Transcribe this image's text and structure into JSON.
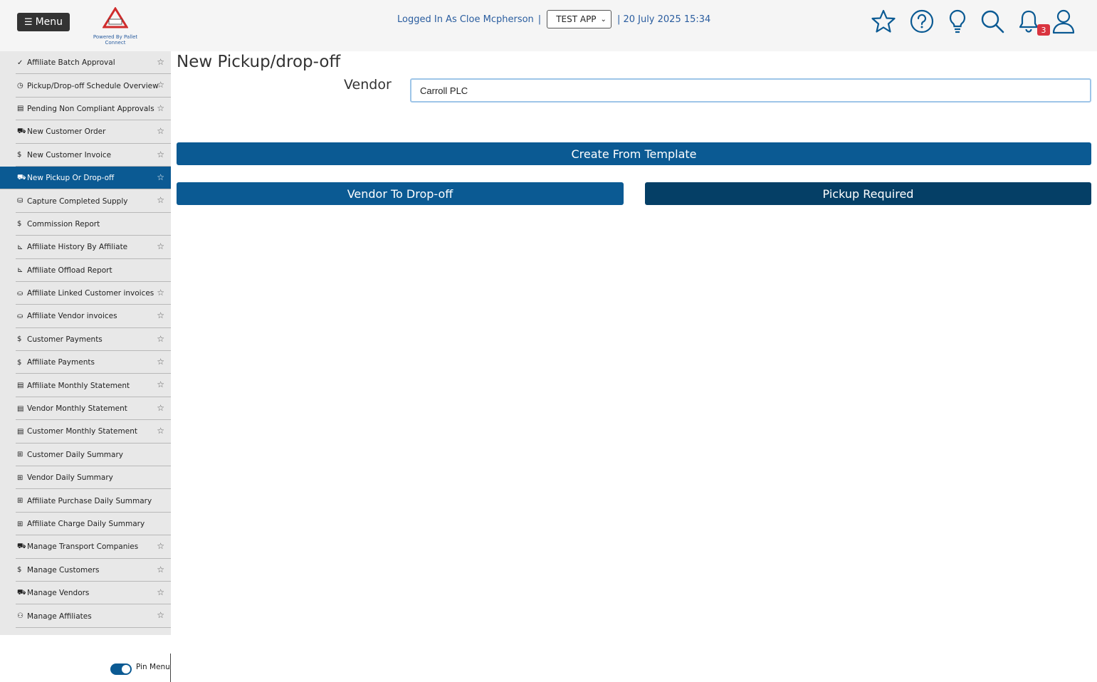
{
  "header": {
    "menu_label": "Menu",
    "logo_caption": "Powered By Pallet Connect",
    "logo_brand": "PALLET CONNECT",
    "logo_badge": "TEST",
    "logged_in_prefix": "Logged In As Cloe Mcpherson",
    "separator": "|",
    "app_selected": "TEST APP",
    "datetime": "| 20 July 2025 15:34",
    "notification_count": "3",
    "icons": [
      "star-icon",
      "help-icon",
      "lightbulb-icon",
      "search-icon",
      "bell-icon",
      "user-icon"
    ],
    "accent_color": "#0b5a93"
  },
  "sidebar": {
    "items": [
      {
        "icon": "✓",
        "label": "Affiliate Batch Approval",
        "star": true
      },
      {
        "icon": "◷",
        "label": "Pickup/Drop-off Schedule Overview",
        "star": true
      },
      {
        "icon": "▤",
        "label": "Pending Non Compliant Approvals",
        "star": true
      },
      {
        "icon": "⛟",
        "label": "New Customer Order",
        "star": true
      },
      {
        "icon": "$",
        "label": "New Customer Invoice",
        "star": true
      },
      {
        "icon": "⛟",
        "label": "New Pickup Or Drop-off",
        "star": true,
        "active": true
      },
      {
        "icon": "⛁",
        "label": "Capture Completed Supply",
        "star": true
      },
      {
        "icon": "$",
        "label": "Commission Report",
        "star": false
      },
      {
        "icon": "⊾",
        "label": "Affiliate History By Affiliate",
        "star": true
      },
      {
        "icon": "⊾",
        "label": "Affiliate Offload Report",
        "star": false
      },
      {
        "icon": "⛀",
        "label": "Affiliate Linked Customer invoices",
        "star": true
      },
      {
        "icon": "⛀",
        "label": "Affiliate Vendor invoices",
        "star": true
      },
      {
        "icon": "$",
        "label": "Customer Payments",
        "star": true
      },
      {
        "icon": "$",
        "label": "Affiliate Payments",
        "star": true
      },
      {
        "icon": "▤",
        "label": "Affiliate Monthly Statement",
        "star": true
      },
      {
        "icon": "▤",
        "label": "Vendor Monthly Statement",
        "star": true
      },
      {
        "icon": "▤",
        "label": "Customer Monthly Statement",
        "star": true
      },
      {
        "icon": "⊞",
        "label": "Customer Daily Summary",
        "star": false
      },
      {
        "icon": "⊞",
        "label": "Vendor Daily Summary",
        "star": false
      },
      {
        "icon": "⊞",
        "label": "Affiliate Purchase Daily Summary",
        "star": false
      },
      {
        "icon": "⊞",
        "label": "Affiliate Charge Daily Summary",
        "star": false
      },
      {
        "icon": "⛟",
        "label": "Manage Transport Companies",
        "star": true
      },
      {
        "icon": "$",
        "label": "Manage Customers",
        "star": true
      },
      {
        "icon": "⛟",
        "label": "Manage Vendors",
        "star": true
      },
      {
        "icon": "⚇",
        "label": "Manage Affiliates",
        "star": true
      }
    ],
    "pin_label": "Pin Menu",
    "pin_enabled": true
  },
  "main": {
    "title": "New Pickup/drop-off",
    "vendor_label": "Vendor",
    "vendor_value": "Carroll PLC",
    "create_template_label": "Create From Template",
    "vendor_dropoff_label": "Vendor To Drop-off",
    "pickup_required_label": "Pickup Required"
  }
}
